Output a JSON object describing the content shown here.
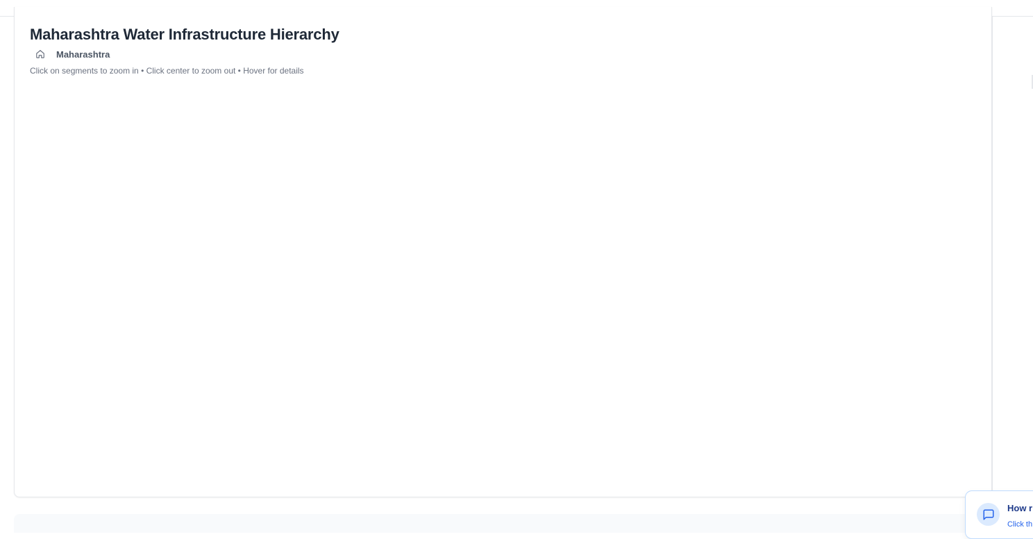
{
  "page": {
    "title": "Maharashtra Water Infrastructure Hierarchy"
  },
  "breadcrumb": {
    "home_icon": "home-icon",
    "items": [
      {
        "label": "Maharashtra"
      }
    ]
  },
  "hint": "Click on segments to zoom in • Click center to zoom out • Hover for details",
  "feedback": {
    "icon": "chat-bubble-icon",
    "title": "How r",
    "subtitle": "Click th"
  },
  "colors": {
    "title_text": "#1f2937",
    "muted_text": "#6b7280",
    "border": "#e5e7eb",
    "feedback_accent": "#2563eb",
    "feedback_title": "#1e3a8a",
    "feedback_icon_bg": "#dbeafe"
  }
}
